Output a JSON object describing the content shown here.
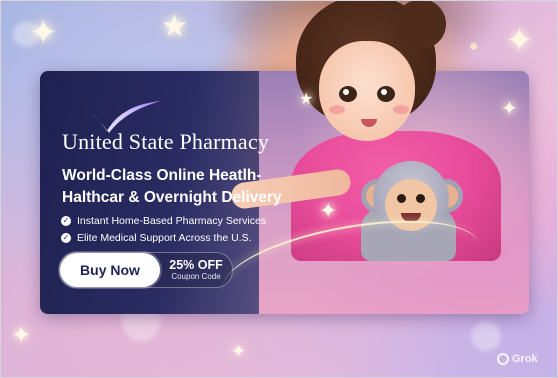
{
  "brand": {
    "name": "United State Pharmacy"
  },
  "headline": {
    "line1": "World-Class Online Heatlh-",
    "line2": "Halthcar & Overnight Delivery"
  },
  "features": [
    "Instant Home-Based Pharmacy Services",
    "Elite Medical Support Across the U.S."
  ],
  "cta": {
    "button_label": "Buy Now",
    "discount": "25% OFF",
    "discount_note": "Coupon Code"
  },
  "watermark": {
    "text": "Grok"
  },
  "colors": {
    "card_dark": "#1e2150",
    "button_bg": "#ffffff",
    "button_text": "#1f2456",
    "shirt_pink": "#e64a98"
  },
  "icons": {
    "feature_bullet": "check-circle-icon",
    "logo": "swoosh-logo-icon",
    "watermark": "grok-icon"
  }
}
